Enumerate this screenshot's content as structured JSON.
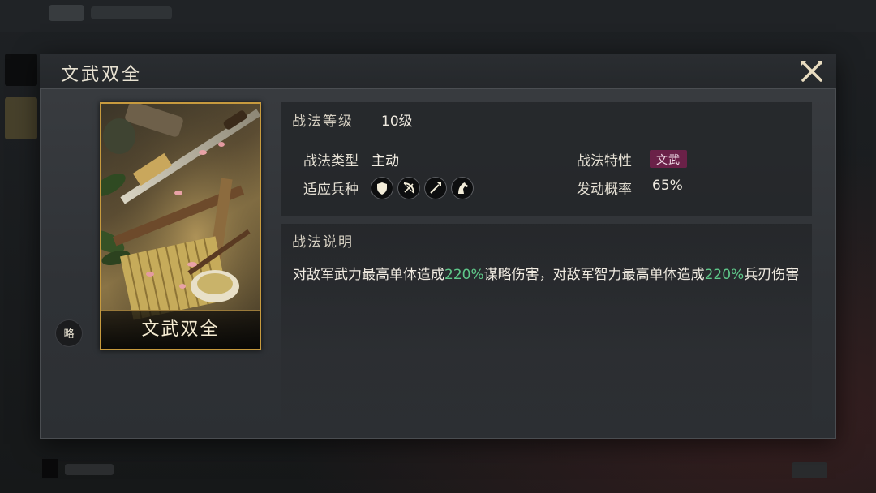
{
  "modal": {
    "title": "文武双全",
    "close_icon": "close-icon"
  },
  "card": {
    "name": "文武双全",
    "strategy_badge": "略"
  },
  "info": {
    "level_label": "战法等级",
    "level_value": "10级",
    "type_label": "战法类型",
    "type_value": "主动",
    "trait_label": "战法特性",
    "trait_value": "文武",
    "troops_label": "适应兵种",
    "troops": [
      {
        "name": "shield-icon"
      },
      {
        "name": "bow-icon"
      },
      {
        "name": "spear-icon"
      },
      {
        "name": "horse-icon"
      }
    ],
    "rate_label": "发动概率",
    "rate_value": "65%"
  },
  "description": {
    "label": "战法说明",
    "parts": [
      "对敌军武力最高单体造成",
      "220%",
      "谋略伤害，对敌军智力最高单体造成",
      "220%",
      "兵刃伤害"
    ]
  },
  "colors": {
    "highlight": "#5fc98a",
    "trait_badge": "#6a2148",
    "card_border": "#c79a3e"
  }
}
